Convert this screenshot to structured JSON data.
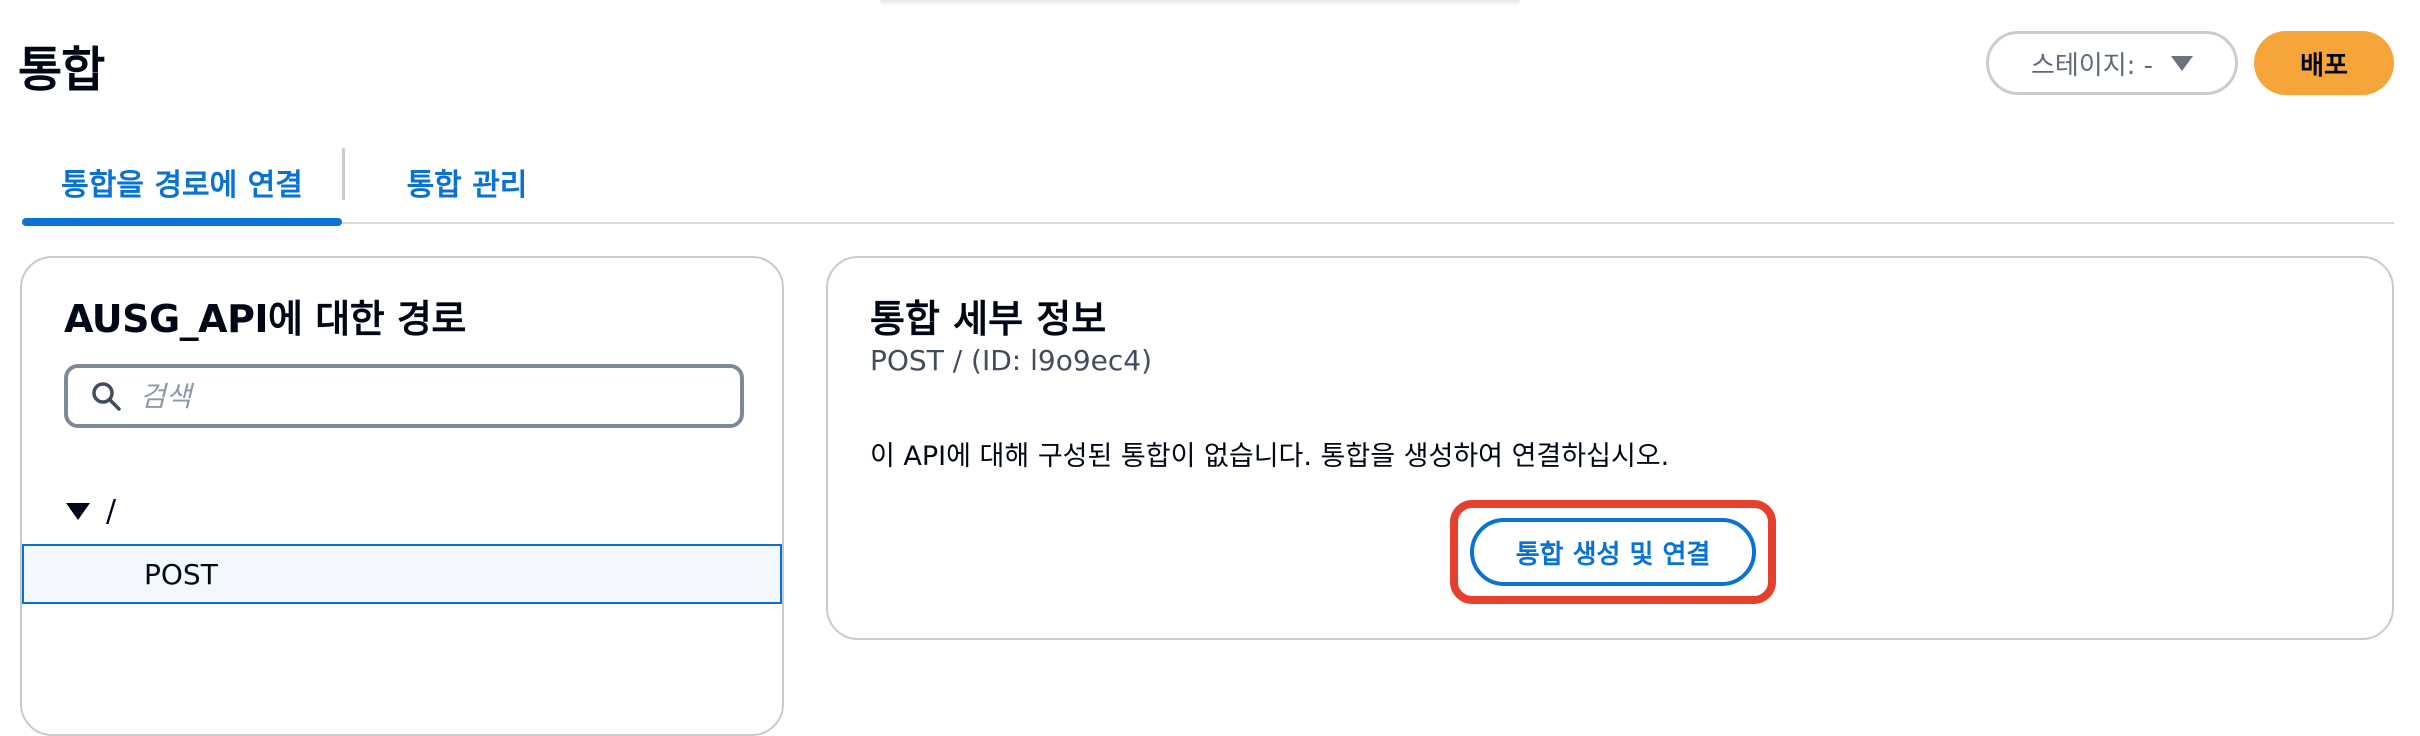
{
  "header": {
    "title": "통합",
    "stage_label": "스테이지: -",
    "deploy_label": "배포"
  },
  "tabs": [
    {
      "label": "통합을 경로에 연결",
      "active": true
    },
    {
      "label": "통합 관리",
      "active": false
    }
  ],
  "routes": {
    "title": "AUSG_API에 대한 경로",
    "search_placeholder": "검색",
    "root": "/",
    "items": [
      {
        "label": "POST",
        "selected": true
      }
    ]
  },
  "details": {
    "title": "통합 세부 정보",
    "subtitle": "POST / (ID: l9o9ec4)",
    "message": "이 API에 대해 구성된 통합이 없습니다. 통합을 생성하여 연결하십시오.",
    "create_button_label": "통합 생성 및 연결"
  },
  "colors": {
    "accent": "#0972d3",
    "deploy": "#f6a53b",
    "highlight": "#e5402d"
  },
  "icons": {
    "search": "search-icon",
    "stage_caret": "caret-down-icon",
    "tree_expand": "caret-down-icon"
  }
}
